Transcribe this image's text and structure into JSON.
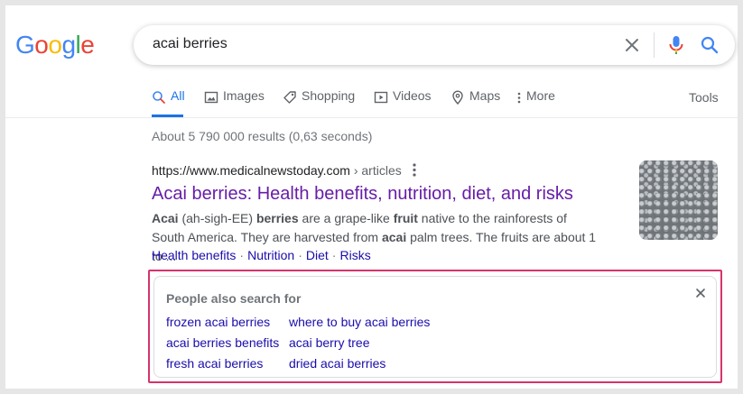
{
  "logo": {
    "letters": [
      {
        "char": "G",
        "color": "#4285f4"
      },
      {
        "char": "o",
        "color": "#ea4335"
      },
      {
        "char": "o",
        "color": "#fbbc05"
      },
      {
        "char": "g",
        "color": "#4285f4"
      },
      {
        "char": "l",
        "color": "#34a853"
      },
      {
        "char": "e",
        "color": "#ea4335"
      }
    ]
  },
  "search": {
    "query": "acai berries",
    "clear_icon": "close-icon",
    "mic_icon": "microphone-icon",
    "search_icon": "search-icon"
  },
  "tabs": [
    {
      "label": "All",
      "icon": "search-icon",
      "active": true
    },
    {
      "label": "Images",
      "icon": "image-icon",
      "active": false
    },
    {
      "label": "Shopping",
      "icon": "tag-icon",
      "active": false
    },
    {
      "label": "Videos",
      "icon": "play-icon",
      "active": false
    },
    {
      "label": "Maps",
      "icon": "map-pin-icon",
      "active": false
    },
    {
      "label": "More",
      "icon": "more-vert-icon",
      "active": false
    }
  ],
  "tools_label": "Tools",
  "stats": "About 5 790 000 results (0,63 seconds)",
  "result": {
    "cite_domain": "https://www.medicalnewstoday.com",
    "cite_path": " › articles",
    "title": "Acai berries: Health benefits, nutrition, diet, and risks",
    "snippet": [
      {
        "text": "Acai",
        "bold": true
      },
      {
        "text": " (ah-sigh-EE) ",
        "bold": false
      },
      {
        "text": "berries",
        "bold": true
      },
      {
        "text": " are a grape-like ",
        "bold": false
      },
      {
        "text": "fruit",
        "bold": true
      },
      {
        "text": " native to the rainforests of South America. They are harvested from ",
        "bold": false
      },
      {
        "text": "acai",
        "bold": true
      },
      {
        "text": " palm trees. The fruits are about 1 to ...",
        "bold": false
      }
    ],
    "sitelinks": [
      "Health benefits",
      "Nutrition",
      "Diet",
      "Risks"
    ],
    "sitelink_separator": "·"
  },
  "people_also_search": {
    "title": "People also search for",
    "close_icon": "close-icon",
    "links": [
      "frozen acai berries",
      "where to buy acai berries",
      "acai berries benefits",
      "acai berry tree",
      "fresh acai berries",
      "dried acai berries"
    ]
  },
  "colors": {
    "link": "#1a0dab",
    "visited": "#681da8",
    "active_tab": "#1a73e8",
    "highlight": "#d6336c"
  }
}
